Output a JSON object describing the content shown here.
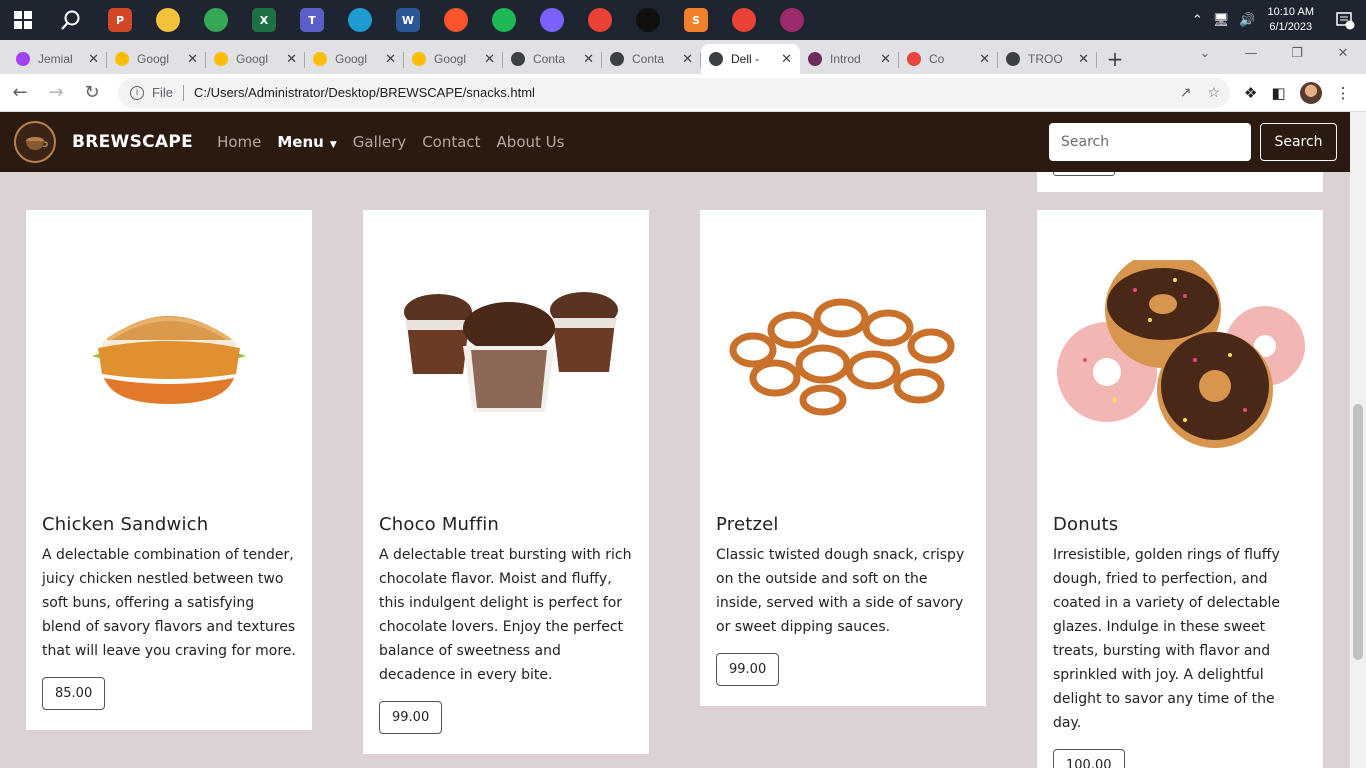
{
  "taskbar": {
    "apps": [
      {
        "name": "powerpoint",
        "letter": "P",
        "color": "#d24726"
      },
      {
        "name": "file-explorer",
        "letter": "",
        "color": "#f5c33b"
      },
      {
        "name": "chrome",
        "letter": "",
        "color": "#34a853"
      },
      {
        "name": "excel",
        "letter": "X",
        "color": "#1e7145"
      },
      {
        "name": "teams",
        "letter": "T",
        "color": "#5b5fc7"
      },
      {
        "name": "edge",
        "letter": "",
        "color": "#1f9bd1"
      },
      {
        "name": "word",
        "letter": "W",
        "color": "#2b5797"
      },
      {
        "name": "brave",
        "letter": "",
        "color": "#fb542b"
      },
      {
        "name": "spotify",
        "letter": "",
        "color": "#1db954"
      },
      {
        "name": "gamebar",
        "letter": "",
        "color": "#7b61ff"
      },
      {
        "name": "chrome-profile",
        "letter": "",
        "color": "#ea4335"
      },
      {
        "name": "recorder",
        "letter": "",
        "color": "#111111"
      },
      {
        "name": "sublime",
        "letter": "S",
        "color": "#f0812a"
      },
      {
        "name": "chrome-profile-2",
        "letter": "",
        "color": "#ea4335"
      },
      {
        "name": "winrar",
        "letter": "",
        "color": "#9c2a6e"
      }
    ],
    "time": "10:10 AM",
    "date": "6/1/2023",
    "notifications": "3"
  },
  "tabs": [
    {
      "title": "Jemial",
      "color": "#a142f4"
    },
    {
      "title": "Googl",
      "color": "#fbbc04"
    },
    {
      "title": "Googl",
      "color": "#fbbc04"
    },
    {
      "title": "Googl",
      "color": "#fbbc04"
    },
    {
      "title": "Googl",
      "color": "#fbbc04"
    },
    {
      "title": "Conta",
      "color": "#3c4043"
    },
    {
      "title": "Conta",
      "color": "#3c4043"
    },
    {
      "title": "Dell - ",
      "color": "#3c4043",
      "active": true
    },
    {
      "title": "Introd",
      "color": "#6b2d5c"
    },
    {
      "title": "Co",
      "color": "#e8453c"
    },
    {
      "title": "TROO",
      "color": "#3c4043"
    }
  ],
  "address": {
    "scheme_label": "File",
    "url": "C:/Users/Administrator/Desktop/BREWSCAPE/snacks.html"
  },
  "site": {
    "brand": "BREWSCAPE",
    "nav": {
      "home": "Home",
      "menu": "Menu",
      "gallery": "Gallery",
      "contact": "Contact",
      "about": "About Us"
    },
    "search_placeholder": "Search",
    "search_button": "Search"
  },
  "products": [
    {
      "name": "Chicken Sandwich",
      "description": "A delectable combination of tender, juicy chicken nestled between two soft buns, offering a satisfying blend of savory flavors and textures that will leave you craving for more.",
      "price": "85.00"
    },
    {
      "name": "Choco Muffin",
      "description": "A delectable treat bursting with rich chocolate flavor. Moist and fluffy, this indulgent delight is perfect for chocolate lovers. Enjoy the perfect balance of sweetness and decadence in every bite.",
      "price": "99.00"
    },
    {
      "name": "Pretzel",
      "description": "Classic twisted dough snack, crispy on the outside and soft on the inside, served with a side of savory or sweet dipping sauces.",
      "price": "99.00"
    },
    {
      "name": "Donuts",
      "description": "Irresistible, golden rings of fluffy dough, fried to perfection, and coated in a variety of delectable glazes. Indulge in these sweet treats, bursting with flavor and sprinkled with joy. A delightful delight to savor any time of the day.",
      "price": "100.00"
    }
  ]
}
